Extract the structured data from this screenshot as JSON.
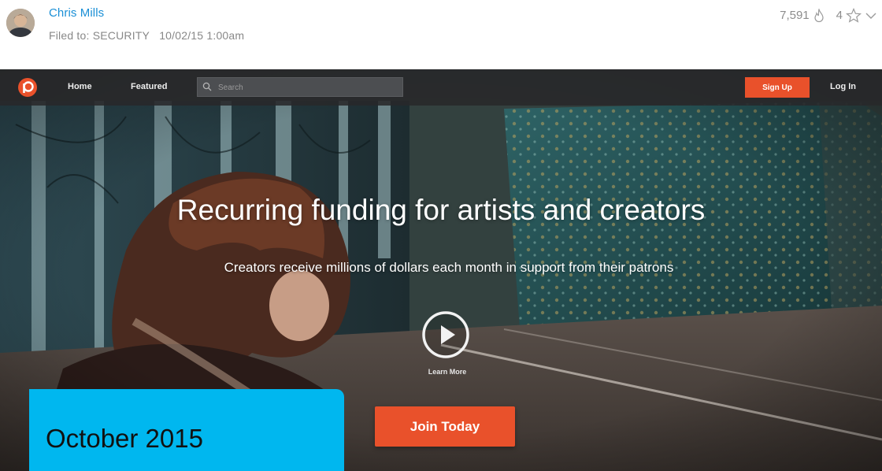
{
  "article": {
    "author": "Chris Mills",
    "filed_prefix": "Filed to:",
    "category": "SECURITY",
    "date": "10/02/15 1:00am",
    "views": "7,591",
    "stars": "4"
  },
  "site": {
    "nav": {
      "home": "Home",
      "featured": "Featured",
      "search_placeholder": "Search",
      "sign_up": "Sign Up",
      "log_in": "Log In"
    },
    "hero": {
      "headline": "Recurring funding for artists and creators",
      "subline": "Creators receive millions of dollars each month in support from their patrons",
      "learn_more": "Learn More",
      "join": "Join Today"
    },
    "colors": {
      "accent": "#e9512b",
      "caption_bg": "#00b7ef",
      "author_link": "#1a8fd6"
    }
  },
  "caption": {
    "text": "October 2015"
  },
  "icons": {
    "logo": "patreon-logo-icon",
    "search": "search-icon",
    "views": "flame-icon",
    "star": "star-icon",
    "dropdown": "chevron-down-icon",
    "play": "play-icon"
  }
}
